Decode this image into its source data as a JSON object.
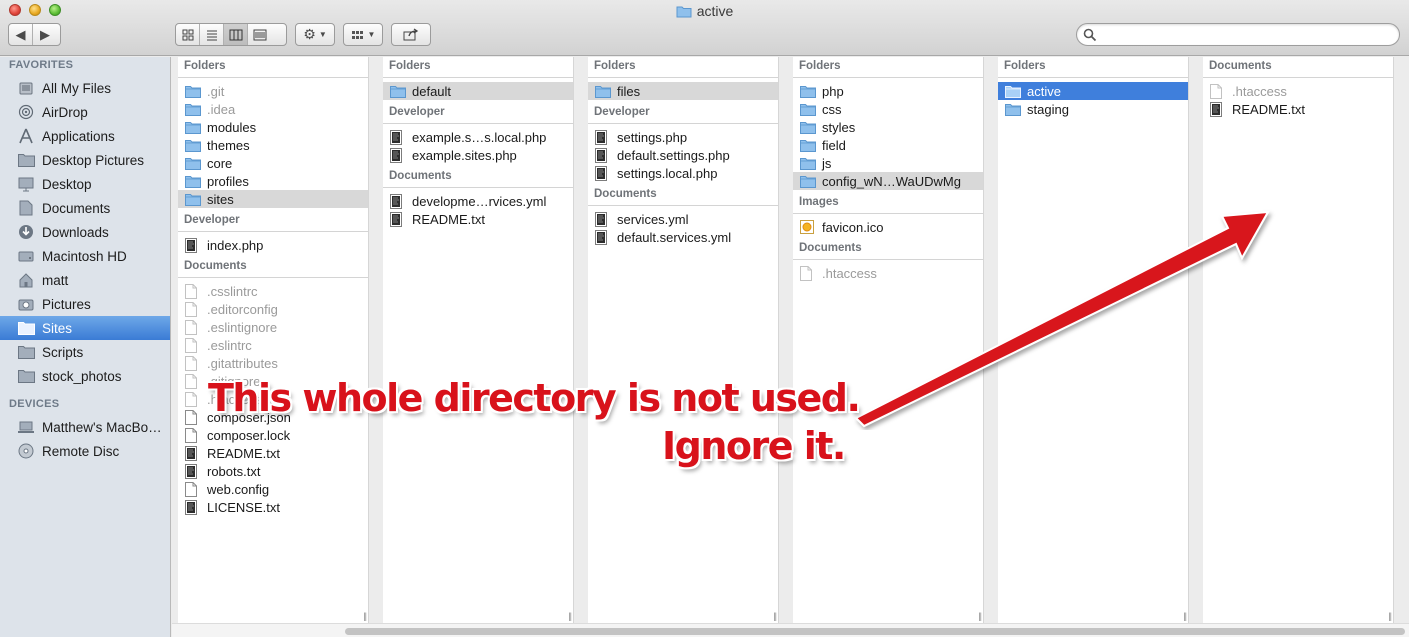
{
  "window": {
    "title": "active"
  },
  "toolbar": {
    "back_icon": "chevron-left-icon",
    "forward_icon": "chevron-right-icon",
    "view_modes": [
      "icon-view-icon",
      "list-view-icon",
      "column-view-icon",
      "cover-flow-icon"
    ],
    "selected_view": "column-view-icon",
    "action_icon": "gear-icon",
    "arrange_icon": "arrange-grid-icon",
    "share_icon": "share-icon",
    "search_placeholder": ""
  },
  "sidebar": {
    "favorites_header": "FAVORITES",
    "favorites": [
      {
        "label": "All My Files",
        "icon": "all-files-icon"
      },
      {
        "label": "AirDrop",
        "icon": "airdrop-icon"
      },
      {
        "label": "Applications",
        "icon": "applications-icon"
      },
      {
        "label": "Desktop Pictures",
        "icon": "folder-icon"
      },
      {
        "label": "Desktop",
        "icon": "desktop-icon"
      },
      {
        "label": "Documents",
        "icon": "documents-icon"
      },
      {
        "label": "Downloads",
        "icon": "downloads-icon"
      },
      {
        "label": "Macintosh HD",
        "icon": "harddisk-icon"
      },
      {
        "label": "matt",
        "icon": "home-icon"
      },
      {
        "label": "Pictures",
        "icon": "camera-icon"
      },
      {
        "label": "Sites",
        "icon": "folder-icon",
        "selected": true
      },
      {
        "label": "Scripts",
        "icon": "folder-icon"
      },
      {
        "label": "stock_photos",
        "icon": "folder-icon"
      }
    ],
    "devices_header": "DEVICES",
    "devices": [
      {
        "label": "Matthew's MacBo…",
        "icon": "laptop-icon"
      },
      {
        "label": "Remote Disc",
        "icon": "disc-icon"
      }
    ]
  },
  "columns": [
    {
      "sections": [
        {
          "header": "Folders",
          "items": [
            {
              "name": ".git",
              "kind": "folder",
              "dim": true
            },
            {
              "name": ".idea",
              "kind": "folder",
              "dim": true
            },
            {
              "name": "modules",
              "kind": "folder"
            },
            {
              "name": "themes",
              "kind": "folder"
            },
            {
              "name": "core",
              "kind": "folder"
            },
            {
              "name": "profiles",
              "kind": "folder"
            },
            {
              "name": "sites",
              "kind": "folder",
              "state": "hl"
            }
          ]
        },
        {
          "header": "Developer",
          "items": [
            {
              "name": "index.php",
              "kind": "code"
            }
          ]
        },
        {
          "header": "Documents",
          "items": [
            {
              "name": ".csslintrc",
              "kind": "doc",
              "dim": true
            },
            {
              "name": ".editorconfig",
              "kind": "doc",
              "dim": true
            },
            {
              "name": ".eslintignore",
              "kind": "doc",
              "dim": true
            },
            {
              "name": ".eslintrc",
              "kind": "doc",
              "dim": true
            },
            {
              "name": ".gitattributes",
              "kind": "doc",
              "dim": true
            },
            {
              "name": ".gitignore",
              "kind": "doc",
              "dim": true
            },
            {
              "name": ".htaccess",
              "kind": "doc",
              "dim": true
            },
            {
              "name": "composer.json",
              "kind": "doc"
            },
            {
              "name": "composer.lock",
              "kind": "doc"
            },
            {
              "name": "README.txt",
              "kind": "code"
            },
            {
              "name": "robots.txt",
              "kind": "code"
            },
            {
              "name": "web.config",
              "kind": "doc"
            },
            {
              "name": "LICENSE.txt",
              "kind": "code"
            }
          ]
        }
      ]
    },
    {
      "sections": [
        {
          "header": "Folders",
          "items": [
            {
              "name": "default",
              "kind": "folder",
              "state": "hl"
            }
          ]
        },
        {
          "header": "Developer",
          "items": [
            {
              "name": "example.s…s.local.php",
              "kind": "code"
            },
            {
              "name": "example.sites.php",
              "kind": "code"
            }
          ]
        },
        {
          "header": "Documents",
          "items": [
            {
              "name": "developme…rvices.yml",
              "kind": "code"
            },
            {
              "name": "README.txt",
              "kind": "code"
            }
          ]
        }
      ]
    },
    {
      "sections": [
        {
          "header": "Folders",
          "items": [
            {
              "name": "files",
              "kind": "folder",
              "state": "hl"
            }
          ]
        },
        {
          "header": "Developer",
          "items": [
            {
              "name": "settings.php",
              "kind": "code"
            },
            {
              "name": "default.settings.php",
              "kind": "code"
            },
            {
              "name": "settings.local.php",
              "kind": "code"
            }
          ]
        },
        {
          "header": "Documents",
          "items": [
            {
              "name": "services.yml",
              "kind": "code"
            },
            {
              "name": "default.services.yml",
              "kind": "code"
            }
          ]
        }
      ]
    },
    {
      "sections": [
        {
          "header": "Folders",
          "items": [
            {
              "name": "php",
              "kind": "folder"
            },
            {
              "name": "css",
              "kind": "folder"
            },
            {
              "name": "styles",
              "kind": "folder"
            },
            {
              "name": "field",
              "kind": "folder"
            },
            {
              "name": "js",
              "kind": "folder"
            },
            {
              "name": "config_wN…WaUDwMg",
              "kind": "folder",
              "state": "hl"
            }
          ]
        },
        {
          "header": "Images",
          "items": [
            {
              "name": "favicon.ico",
              "kind": "image"
            }
          ]
        },
        {
          "header": "Documents",
          "items": [
            {
              "name": ".htaccess",
              "kind": "doc",
              "dim": true
            }
          ]
        }
      ]
    },
    {
      "sections": [
        {
          "header": "Folders",
          "items": [
            {
              "name": "active",
              "kind": "folder",
              "state": "active"
            },
            {
              "name": "staging",
              "kind": "folder"
            }
          ]
        }
      ]
    },
    {
      "sections": [
        {
          "header": "Documents",
          "items": [
            {
              "name": ".htaccess",
              "kind": "doc",
              "dim": true
            },
            {
              "name": "README.txt",
              "kind": "code"
            }
          ]
        }
      ]
    }
  ],
  "annotation": {
    "line1": "This whole directory is not used.",
    "line2": "Ignore it.",
    "color": "#d8121b"
  }
}
